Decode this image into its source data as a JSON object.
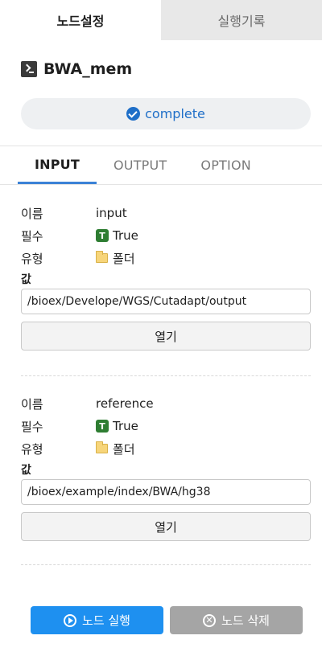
{
  "tabs": {
    "node_settings": "노드설정",
    "run_history": "실행기록"
  },
  "node": {
    "title": "BWA_mem",
    "status": "complete"
  },
  "sub_tabs": [
    "INPUT",
    "OUTPUT",
    "OPTION"
  ],
  "params": [
    {
      "name_label": "이름",
      "name": "input",
      "required_label": "필수",
      "required": "True",
      "type_label": "유형",
      "type": "폴더",
      "value_label": "값",
      "value": "/bioex/Develope/WGS/Cutadapt/output",
      "open_label": "열기"
    },
    {
      "name_label": "이름",
      "name": "reference",
      "required_label": "필수",
      "required": "True",
      "type_label": "유형",
      "type": "폴더",
      "value_label": "값",
      "value": "/bioex/example/index/BWA/hg38",
      "open_label": "열기"
    }
  ],
  "actions": {
    "run": "노드 실행",
    "delete": "노드 삭제"
  },
  "colors": {
    "accent": "#1e90f0",
    "status": "#1f6fc8",
    "true_badge": "#2e7d32",
    "disabled": "#a5a5a5"
  },
  "icons": {
    "node": "terminal-icon",
    "status": "check-circle-icon",
    "required": "t-icon",
    "type": "folder-icon",
    "run": "play-circle-icon",
    "delete": "close-circle-icon"
  }
}
